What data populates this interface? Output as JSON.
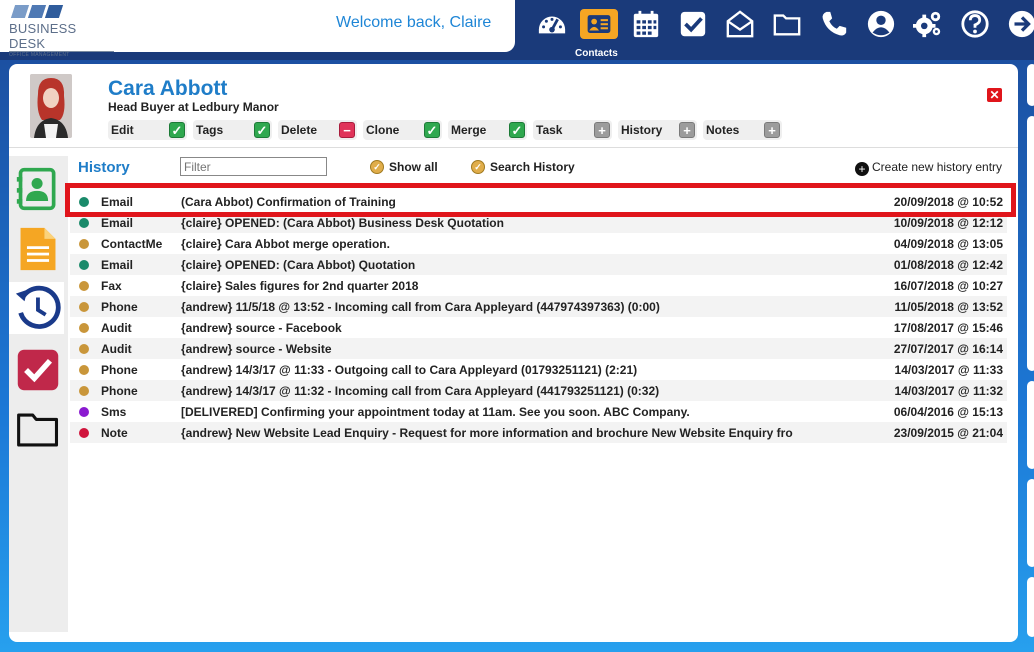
{
  "header": {
    "logo_name": "BUSINESS DESK",
    "logo_sub": "OFFICE MANAGEMENT",
    "welcome": "Welcome back, Claire",
    "nav": [
      {
        "icon": "dashboard-icon"
      },
      {
        "icon": "contacts-icon",
        "active": true,
        "caption": "Contacts"
      },
      {
        "icon": "calendar-icon"
      },
      {
        "icon": "tasks-check-icon"
      },
      {
        "icon": "mail-open-icon"
      },
      {
        "icon": "folder-icon"
      },
      {
        "icon": "phone-icon"
      },
      {
        "icon": "user-circle-icon"
      },
      {
        "icon": "settings-gears-icon"
      },
      {
        "icon": "help-icon"
      },
      {
        "icon": "logout-arrow-icon"
      }
    ],
    "active_caption": "Contacts"
  },
  "contact": {
    "name": "Cara Abbott",
    "role": "Head Buyer at Ledbury Manor",
    "actions": [
      {
        "label": "Edit",
        "icon": "check"
      },
      {
        "label": "Tags",
        "icon": "check"
      },
      {
        "label": "Delete",
        "icon": "minus"
      },
      {
        "label": "Clone",
        "icon": "check"
      },
      {
        "label": "Merge",
        "icon": "check"
      },
      {
        "label": "Task",
        "icon": "plus"
      },
      {
        "label": "History",
        "icon": "plus"
      },
      {
        "label": "Notes",
        "icon": "plus"
      }
    ]
  },
  "history": {
    "title": "History",
    "filter_placeholder": "Filter",
    "show_all": "Show all",
    "search_history": "Search History",
    "create_new": "Create new history entry",
    "rows": [
      {
        "type": "Email",
        "color": "#1a8a6a",
        "desc": "(Cara Abbot) Confirmation of Training",
        "date": "20/09/2018 @ 10:52"
      },
      {
        "type": "Email",
        "color": "#1a8a6a",
        "desc": "{claire} OPENED: (Cara Abbot) Business Desk Quotation",
        "date": "10/09/2018 @ 12:12"
      },
      {
        "type": "ContactMerge",
        "color": "#c9963a",
        "desc": "{claire} Cara Abbot merge operation.",
        "date": "04/09/2018 @ 13:05"
      },
      {
        "type": "Email",
        "color": "#1a8a6a",
        "desc": "{claire} OPENED: (Cara Abbot) Quotation",
        "date": "01/08/2018 @ 12:42"
      },
      {
        "type": "Fax",
        "color": "#c9963a",
        "desc": "{claire} Sales figures for 2nd quarter 2018",
        "date": "16/07/2018 @ 10:27"
      },
      {
        "type": "Phone",
        "color": "#c9963a",
        "desc": "{andrew} 11/5/18 @ 13:52 - Incoming call from Cara Appleyard (447974397363) (0:00)",
        "date": "11/05/2018 @ 13:52"
      },
      {
        "type": "Audit",
        "color": "#c9963a",
        "desc": "{andrew} source - Facebook",
        "date": "17/08/2017 @ 15:46"
      },
      {
        "type": "Audit",
        "color": "#c9963a",
        "desc": "{andrew} source - Website",
        "date": "27/07/2017 @ 16:14"
      },
      {
        "type": "Phone",
        "color": "#c9963a",
        "desc": "{andrew} 14/3/17 @ 11:33 - Outgoing call to Cara Appleyard (01793251121) (2:21)",
        "date": "14/03/2017 @ 11:33"
      },
      {
        "type": "Phone",
        "color": "#c9963a",
        "desc": "{andrew} 14/3/17 @ 11:32 - Incoming call from Cara Appleyard (441793251121) (0:32)",
        "date": "14/03/2017 @ 11:32"
      },
      {
        "type": "Sms",
        "color": "#8a1ad0",
        "desc": "[DELIVERED] Confirming your appointment today at 11am.  See you soon. ABC Company.",
        "date": "06/04/2016 @ 15:13"
      },
      {
        "type": "Note",
        "color": "#d0153c",
        "desc": "{andrew} New Website Lead Enquiry - Request for more information and brochure New Website Enquiry from",
        "date": "23/09/2015 @ 21:04"
      }
    ]
  },
  "sidebar": [
    {
      "icon": "contact-card-icon",
      "color": "#2fa84f"
    },
    {
      "icon": "document-icon",
      "color": "#f5a623"
    },
    {
      "icon": "history-clock-icon",
      "color": "#1a3a8a"
    },
    {
      "icon": "task-check-icon",
      "color": "#c0284a"
    },
    {
      "icon": "folder-icon",
      "color": "#111111"
    }
  ],
  "colors": {
    "brand_blue": "#1f7dc8",
    "nav_bg": "#1a3a7a",
    "highlight": "#e0151b"
  }
}
